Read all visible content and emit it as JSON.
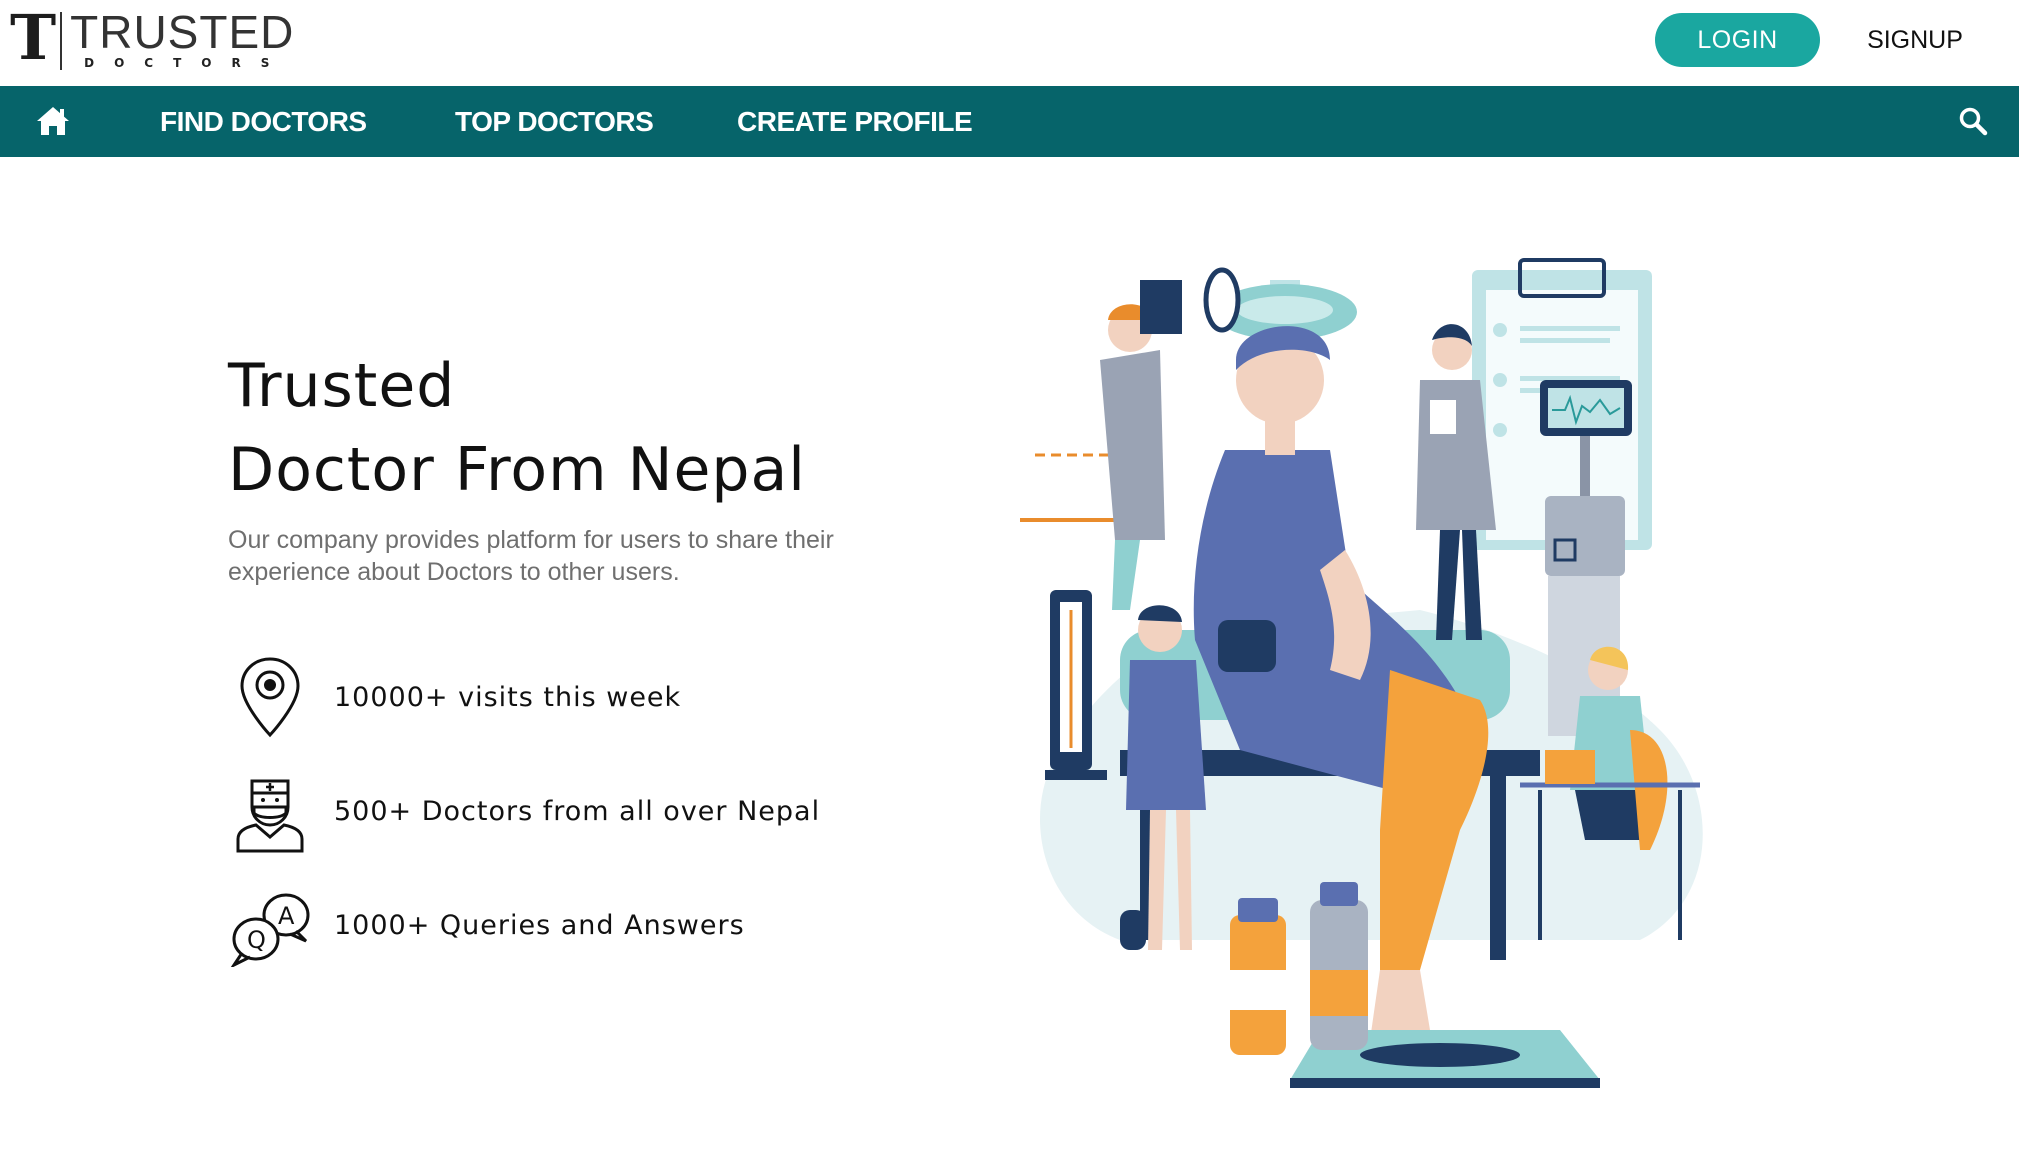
{
  "header": {
    "logo_mark": "T",
    "logo_word": "TRUSTED",
    "logo_sub": "DOCTORS",
    "login_label": "LOGIN",
    "signup_label": "SIGNUP"
  },
  "nav": {
    "home_icon": "home-icon",
    "items": [
      {
        "label": "FIND DOCTORS"
      },
      {
        "label": "TOP DOCTORS"
      },
      {
        "label": "CREATE PROFILE"
      }
    ],
    "search_icon": "search-icon"
  },
  "hero": {
    "title_line1": "Trusted",
    "title_line2": "Doctor From Nepal",
    "description": "Our company provides platform for users to share their experience about Doctors to other users.",
    "features": [
      {
        "icon": "location-pin-icon",
        "text": "10000+ visits this week"
      },
      {
        "icon": "doctor-icon",
        "text": "500+ Doctors from all over Nepal"
      },
      {
        "icon": "qa-bubbles-icon",
        "text": "1000+ Queries and Answers"
      }
    ]
  },
  "colors": {
    "nav_bg": "#06646a",
    "login_bg": "#1aa7a0",
    "text_dark": "#111111",
    "text_muted": "#6f6f6f"
  }
}
